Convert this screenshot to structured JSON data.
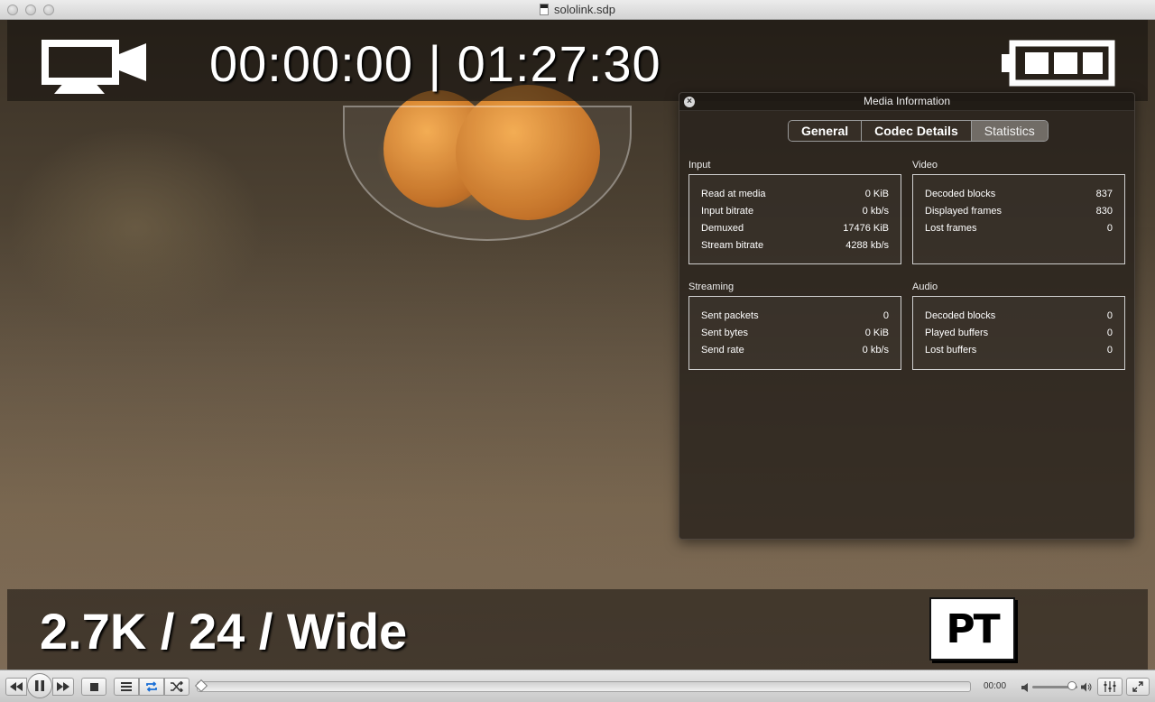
{
  "window": {
    "title": "sololink.sdp"
  },
  "overlay": {
    "timecode": "00:00:00 | 01:27:30",
    "mode": "2.7K / 24 / Wide",
    "logo_text": "PT"
  },
  "media_info": {
    "title": "Media Information",
    "tabs": [
      {
        "label": "General",
        "active": false
      },
      {
        "label": "Codec Details",
        "active": false
      },
      {
        "label": "Statistics",
        "active": true
      }
    ],
    "sections": {
      "input": {
        "label": "Input",
        "rows": [
          {
            "name": "Read at media",
            "value": "0 KiB"
          },
          {
            "name": "Input bitrate",
            "value": "0 kb/s"
          },
          {
            "name": "Demuxed",
            "value": "17476 KiB"
          },
          {
            "name": "Stream bitrate",
            "value": "4288 kb/s"
          }
        ]
      },
      "video": {
        "label": "Video",
        "rows": [
          {
            "name": "Decoded blocks",
            "value": "837"
          },
          {
            "name": "Displayed frames",
            "value": "830"
          },
          {
            "name": "Lost frames",
            "value": "0"
          }
        ]
      },
      "streaming": {
        "label": "Streaming",
        "rows": [
          {
            "name": "Sent packets",
            "value": "0"
          },
          {
            "name": "Sent bytes",
            "value": "0 KiB"
          },
          {
            "name": "Send rate",
            "value": "0 kb/s"
          }
        ]
      },
      "audio": {
        "label": "Audio",
        "rows": [
          {
            "name": "Decoded blocks",
            "value": "0"
          },
          {
            "name": "Played buffers",
            "value": "0"
          },
          {
            "name": "Lost buffers",
            "value": "0"
          }
        ]
      }
    }
  },
  "controls": {
    "elapsed": "00:00",
    "position_fraction": 0.0,
    "volume_fraction": 0.85,
    "accent": "#1a6fd6"
  }
}
